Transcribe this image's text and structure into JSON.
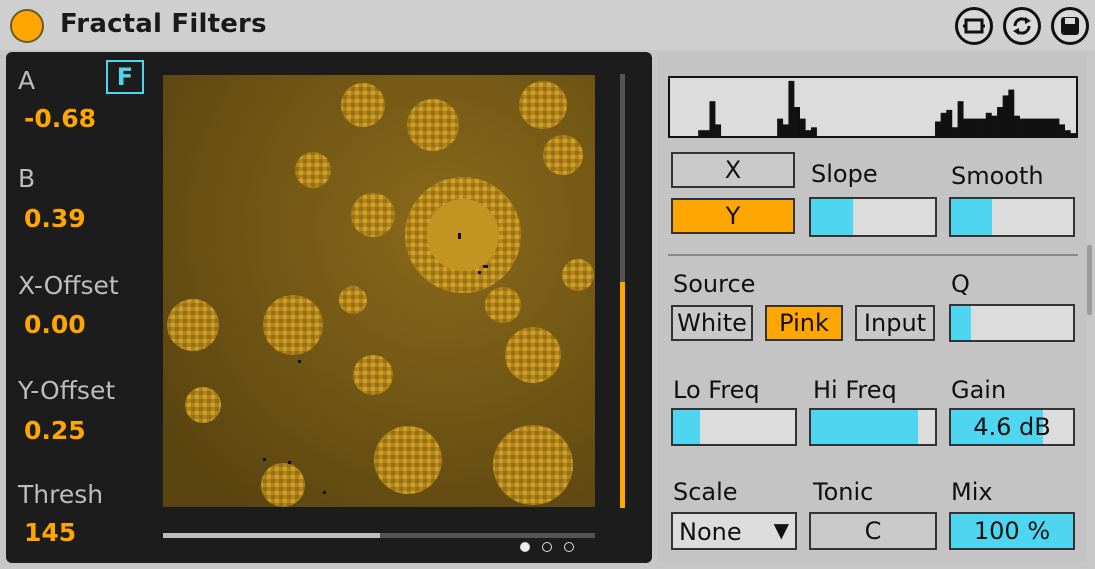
{
  "device": {
    "title": "Fractal Filters",
    "accent": "#ffa600",
    "cyan": "#4ed6f0"
  },
  "header_icons": [
    "hot-swap-icon",
    "refresh-icon",
    "save-icon"
  ],
  "left": {
    "f_button": "F",
    "params": [
      {
        "label": "A",
        "value": "-0.68"
      },
      {
        "label": "B",
        "value": "0.39"
      },
      {
        "label": "X-Offset",
        "value": "0.00"
      },
      {
        "label": "Y-Offset",
        "value": "0.25"
      },
      {
        "label": "Thresh",
        "value": "145"
      }
    ],
    "vertical_scroll_fraction": 0.52,
    "horizontal_scroll_fraction": 0.5,
    "pages": {
      "count": 3,
      "active": 0
    }
  },
  "right": {
    "histogram": [
      0,
      0,
      0,
      0,
      0,
      0.1,
      0.1,
      0.6,
      0.2,
      0,
      0,
      0,
      0,
      0,
      0,
      0,
      0,
      0,
      0,
      0.3,
      0.2,
      0.95,
      0.5,
      0.3,
      0.1,
      0.15,
      0,
      0,
      0,
      0,
      0,
      0,
      0,
      0,
      0,
      0,
      0,
      0,
      0,
      0,
      0,
      0,
      0,
      0,
      0,
      0,
      0,
      0.25,
      0.4,
      0.45,
      0.15,
      0.6,
      0.3,
      0.3,
      0.3,
      0.3,
      0.4,
      0.35,
      0.5,
      0.7,
      0.8,
      0.35,
      0.3,
      0.3,
      0.3,
      0.3,
      0.3,
      0.3,
      0.3,
      0.2,
      0.1,
      0.05
    ],
    "x_button": "X",
    "y_button": "Y",
    "slope": {
      "label": "Slope",
      "value_fraction": 0.36
    },
    "smooth": {
      "label": "Smooth",
      "value_fraction": 0.34
    },
    "source": {
      "label": "Source",
      "options": [
        "White",
        "Pink",
        "Input"
      ],
      "selected": "Pink"
    },
    "q": {
      "label": "Q",
      "value_fraction": 0.16
    },
    "lo_freq": {
      "label": "Lo Freq",
      "value_fraction": 0.22
    },
    "hi_freq": {
      "label": "Hi Freq",
      "value_fraction": 0.86
    },
    "gain": {
      "label": "Gain",
      "value": "4.6 dB",
      "value_fraction": 0.75
    },
    "scale": {
      "label": "Scale",
      "value": "None",
      "arrow": "▼"
    },
    "tonic": {
      "label": "Tonic",
      "value": "C"
    },
    "mix": {
      "label": "Mix",
      "value": "100 %",
      "value_fraction": 1.0
    }
  }
}
